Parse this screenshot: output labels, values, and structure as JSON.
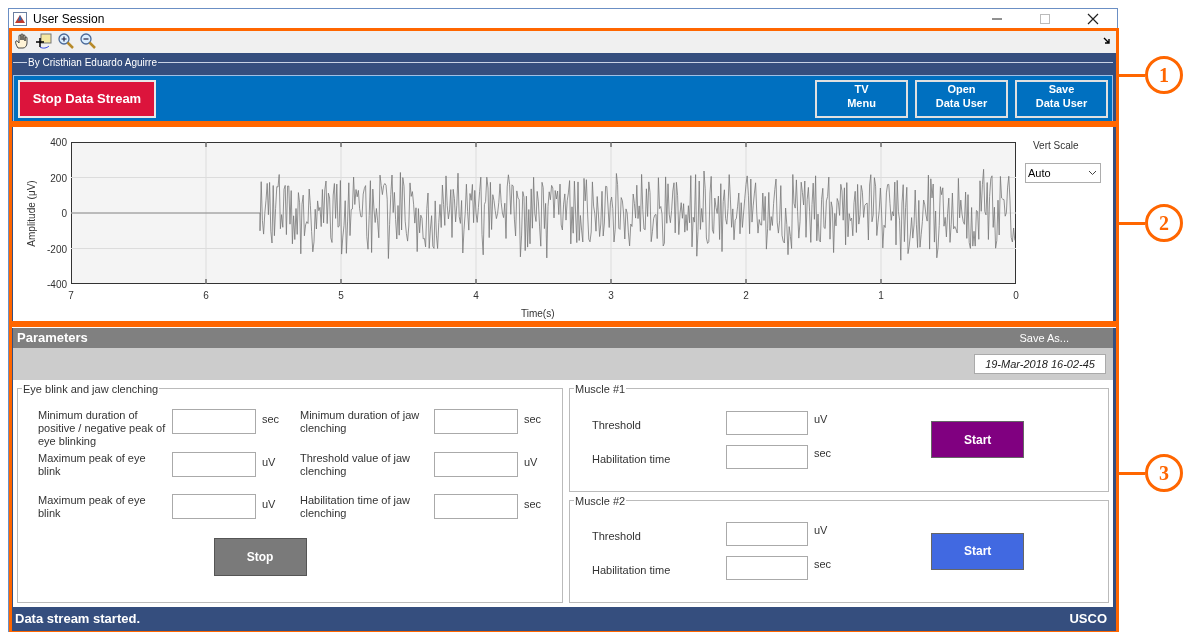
{
  "window": {
    "title": "User Session"
  },
  "header": {
    "caption": "By Cristhian Eduardo Aguirre",
    "stream_button": "Stop Data Stream",
    "buttons": [
      {
        "line1": "TV",
        "line2": "Menu"
      },
      {
        "line1": "Open",
        "line2": "Data User"
      },
      {
        "line1": "Save",
        "line2": "Data User"
      }
    ]
  },
  "plot": {
    "ylabel": "Amplitude (μV)",
    "xlabel": "Time(s)",
    "yticks": [
      "400",
      "200",
      "0",
      "-200",
      "-400"
    ],
    "xticks": [
      "7",
      "6",
      "5",
      "4",
      "3",
      "2",
      "1",
      "0"
    ],
    "scale_label": "Vert Scale",
    "scale_value": "Auto"
  },
  "parameters": {
    "title": "Parameters",
    "save_as": "Save As...",
    "timestamp": "19-Mar-2018 16-02-45"
  },
  "eye_group": {
    "title": "Eye blink and jaw clenching",
    "fields": [
      {
        "label": "Minimum duration of positive / negative peak of eye blinking",
        "unit": "sec"
      },
      {
        "label": "Minimum duration of jaw clenching",
        "unit": "sec"
      },
      {
        "label": "Maximum peak of eye blink",
        "unit": "uV"
      },
      {
        "label": "Threshold value of jaw clenching",
        "unit": "uV"
      },
      {
        "label": "Maximum peak of eye blink",
        "unit": "uV"
      },
      {
        "label": "Habilitation time of jaw clenching",
        "unit": "sec"
      }
    ],
    "button": "Stop"
  },
  "muscles": [
    {
      "title": "Muscle #1",
      "fields": [
        {
          "label": "Threshold",
          "unit": "uV"
        },
        {
          "label": "Habilitation time",
          "unit": "sec"
        }
      ],
      "button": "Start",
      "color": "#800080"
    },
    {
      "title": "Muscle #2",
      "fields": [
        {
          "label": "Threshold",
          "unit": "uV"
        },
        {
          "label": "Habilitation time",
          "unit": "sec"
        }
      ],
      "button": "Start",
      "color": "#4169e1"
    }
  ],
  "status_bar": {
    "message": "Data stream started.",
    "brand": "USCO"
  },
  "callouts": [
    {
      "label": "1"
    },
    {
      "label": "2"
    },
    {
      "label": "3"
    }
  ]
}
